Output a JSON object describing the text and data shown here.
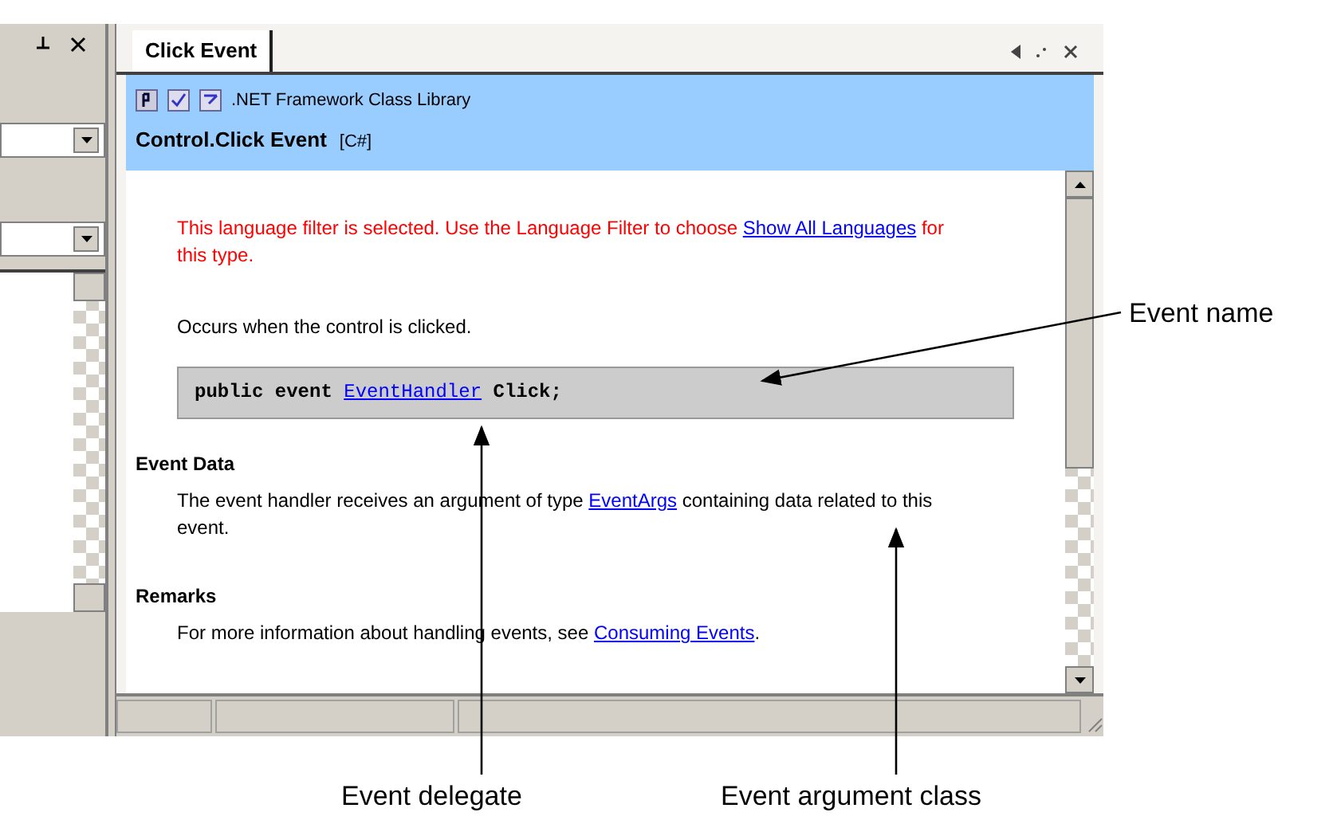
{
  "help_window": {
    "tab": {
      "label": "Click Event",
      "selected": true
    },
    "header": {
      "library": ".NET Framework Class Library",
      "title": "Control.Click Event",
      "language": "[C#]"
    },
    "notice": [
      {
        "kind": "text",
        "text": "This language filter is selected. Use the Language Filter to choose "
      },
      {
        "kind": "link",
        "text": "Show All Languages"
      },
      {
        "kind": "text",
        "text": " for this type."
      }
    ],
    "summary": "Occurs when the control is clicked.",
    "syntax": [
      {
        "kind": "text",
        "text": "public event "
      },
      {
        "kind": "link",
        "text": "EventHandler"
      },
      {
        "kind": "text",
        "text": " Click;"
      }
    ],
    "sections": [
      {
        "heading": "Event Data",
        "paragraph": [
          {
            "kind": "text",
            "text": "The event handler receives an argument of type "
          },
          {
            "kind": "link",
            "text": "EventArgs"
          },
          {
            "kind": "text",
            "text": " containing data related to this event."
          }
        ]
      },
      {
        "heading": "Remarks",
        "paragraph": [
          {
            "kind": "text",
            "text": "For more information about handling events, see "
          },
          {
            "kind": "link",
            "text": "Consuming Events"
          },
          {
            "kind": "text",
            "text": "."
          }
        ]
      }
    ]
  },
  "annotations": [
    {
      "label": "Event name"
    },
    {
      "label": "Event delegate"
    },
    {
      "label": "Event argument class"
    }
  ]
}
